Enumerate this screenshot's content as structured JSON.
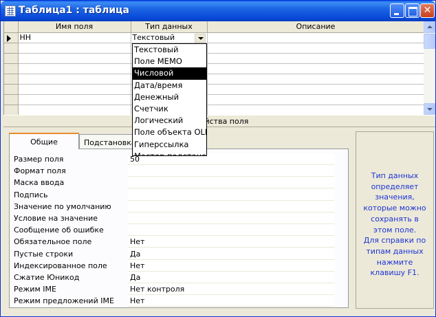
{
  "window": {
    "title": "Таблица1 : таблица"
  },
  "grid": {
    "columns": [
      "Имя поля",
      "Тип данных",
      "Описание"
    ],
    "rows": [
      {
        "name": "НН",
        "type": "Текстовый",
        "description": ""
      }
    ],
    "empty_row_count": 7
  },
  "dropdown": {
    "options": [
      "Текстовый",
      "Поле MEMO",
      "Числовой",
      "Дата/время",
      "Денежный",
      "Счетчик",
      "Логический",
      "Поле объекта OLE",
      "Гиперссылка",
      "Мастер подстановок..."
    ],
    "highlighted": "Числовой"
  },
  "properties_bar": {
    "label": "Свойства поля"
  },
  "tabs": [
    {
      "label": "Общие",
      "active": true
    },
    {
      "label": "Подстановка",
      "active": false
    }
  ],
  "properties": [
    {
      "label": "Размер поля",
      "value": "50"
    },
    {
      "label": "Формат поля",
      "value": ""
    },
    {
      "label": "Маска ввода",
      "value": ""
    },
    {
      "label": "Подпись",
      "value": ""
    },
    {
      "label": "Значение по умолчанию",
      "value": ""
    },
    {
      "label": "Условие на значение",
      "value": ""
    },
    {
      "label": "Сообщение об ошибке",
      "value": ""
    },
    {
      "label": "Обязательное поле",
      "value": "Нет"
    },
    {
      "label": "Пустые строки",
      "value": "Да"
    },
    {
      "label": "Индексированное поле",
      "value": "Нет"
    },
    {
      "label": "Сжатие Юникод",
      "value": "Да"
    },
    {
      "label": "Режим IME",
      "value": "Нет контроля"
    },
    {
      "label": "Режим предложений IME",
      "value": "Нет"
    }
  ],
  "help": {
    "lines": [
      "Тип данных",
      "определяет",
      "значения,",
      "которые можно",
      "сохранять в",
      "этом поле.",
      "Для справки по",
      "типам данных",
      "нажмите",
      "клавишу F1."
    ]
  },
  "colors": {
    "title_bar": "#0a5ee6",
    "help_text": "#1c33d6",
    "selection": "#000000"
  }
}
